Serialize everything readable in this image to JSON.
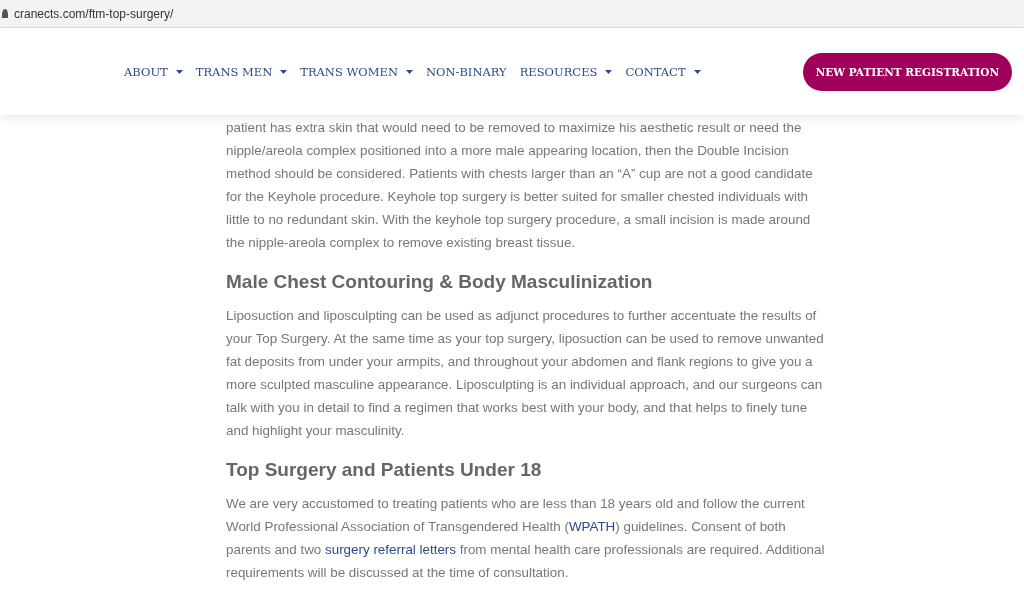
{
  "address_bar": {
    "url": "cranects.com/ftm-top-surgery/"
  },
  "nav": {
    "items": [
      {
        "label": "ABOUT",
        "dropdown": true
      },
      {
        "label": "TRANS MEN",
        "dropdown": true
      },
      {
        "label": "TRANS WOMEN",
        "dropdown": true
      },
      {
        "label": "NON-BINARY",
        "dropdown": false
      },
      {
        "label": "RESOURCES",
        "dropdown": true
      },
      {
        "label": "CONTACT",
        "dropdown": true
      }
    ],
    "cta_button": "NEW PATIENT REGISTRATION"
  },
  "content": [
    {
      "kind": "paragraph",
      "parts": [
        {
          "text": "patient has extra skin that would need to be removed to maximize his aesthetic result or need the nipple/areola complex positioned into a more male appearing location, then the Double Incision method should be considered. Patients with chests larger than an “A” cup are not a good candidate for the Keyhole procedure. Keyhole top surgery is better suited for smaller chested individuals with little to no redundant skin. With the keyhole top surgery procedure, a small incision is made around the nipple-areola complex to remove existing breast tissue.",
          "link": false
        }
      ]
    },
    {
      "kind": "heading",
      "text": "Male Chest Contouring & Body Masculinization"
    },
    {
      "kind": "paragraph",
      "parts": [
        {
          "text": "Liposuction and liposculpting can be used as adjunct procedures to further accentuate the results of your Top Surgery. At the same time as your top surgery, liposuction can be used to remove unwanted fat deposits from under your armpits, and throughout your abdomen and flank regions to give you a more sculpted masculine appearance. Liposculpting is an individual approach, and our surgeons can talk with you in detail to find a regimen that works best with your body, and that helps to finely tune and highlight your masculinity.",
          "link": false
        }
      ]
    },
    {
      "kind": "heading",
      "text": "Top Surgery and Patients Under 18"
    },
    {
      "kind": "paragraph",
      "parts": [
        {
          "text": "We are very accustomed to treating patients who are less than 18 years old and follow the current World Professional Association of Transgendered Health (",
          "link": false
        },
        {
          "text": "WPATH",
          "link": true
        },
        {
          "text": ") guidelines. Consent of both parents and two ",
          "link": false
        },
        {
          "text": "surgery referral letters",
          "link": true
        },
        {
          "text": " from mental health care professionals are required.  Additional requirements will be discussed at the time of consultation.",
          "link": false
        }
      ]
    }
  ]
}
